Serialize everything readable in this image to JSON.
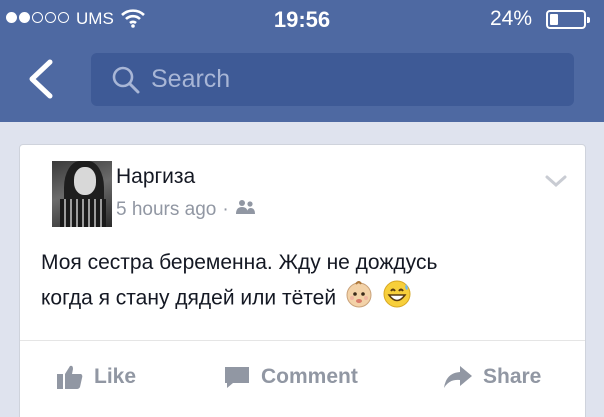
{
  "status_bar": {
    "carrier": "UMS",
    "time": "19:56",
    "battery_percent": "24%",
    "battery_level": 0.24,
    "signal_bars_filled": 2,
    "signal_bars_total": 5
  },
  "nav": {
    "back_icon": "chevron-left-icon",
    "search_placeholder": "Search",
    "search_value": ""
  },
  "post": {
    "author": "Наргиза",
    "timestamp": "5 hours ago",
    "separator": "·",
    "audience_icon": "friends-icon",
    "text_line1": "Моя сестра беременна. Жду не дождусь",
    "text_line2": "когда я стану дядей или тётей",
    "emojis": [
      "baby-face-emoji",
      "grinning-sweat-emoji"
    ]
  },
  "actions": {
    "like_label": "Like",
    "comment_label": "Comment",
    "share_label": "Share"
  },
  "colors": {
    "nav_bar": "#4e69a2",
    "search_field": "#3e5a96",
    "background": "#dfe3ee",
    "meta_text": "#9197a3"
  }
}
